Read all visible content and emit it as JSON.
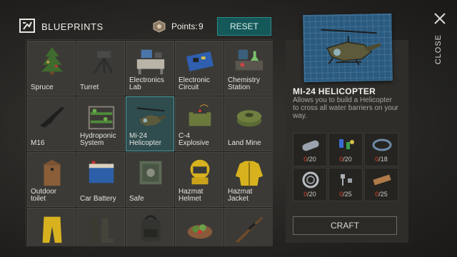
{
  "header": {
    "title": "BLUEPRINTS",
    "points_label": "Points:",
    "points_value": "9",
    "reset_label": "RESET"
  },
  "blueprints": [
    {
      "label": "Spruce",
      "icon": "spruce-icon",
      "selected": false
    },
    {
      "label": "Turret",
      "icon": "turret-icon",
      "selected": false
    },
    {
      "label": "Electronics Lab",
      "icon": "electronics-lab-icon",
      "selected": false
    },
    {
      "label": "Electronic Circuit",
      "icon": "electronic-circuit-icon",
      "selected": false
    },
    {
      "label": "Chemistry Station",
      "icon": "chemistry-station-icon",
      "selected": false
    },
    {
      "label": "M16",
      "icon": "m16-icon",
      "selected": false
    },
    {
      "label": "Hydroponic System",
      "icon": "hydroponic-icon",
      "selected": false
    },
    {
      "label": "Mi-24 Helicopter",
      "icon": "helicopter-icon",
      "selected": true
    },
    {
      "label": "C-4 Explosive",
      "icon": "c4-icon",
      "selected": false
    },
    {
      "label": "Land Mine",
      "icon": "land-mine-icon",
      "selected": false
    },
    {
      "label": "Outdoor toilet",
      "icon": "outdoor-toilet-icon",
      "selected": false
    },
    {
      "label": "Car Battery",
      "icon": "car-battery-icon",
      "selected": false
    },
    {
      "label": "Safe",
      "icon": "safe-icon",
      "selected": false
    },
    {
      "label": "Hazmat Helmet",
      "icon": "hazmat-helmet-icon",
      "selected": false
    },
    {
      "label": "Hazmat Jacket",
      "icon": "hazmat-jacket-icon",
      "selected": false
    },
    {
      "label": "",
      "icon": "hazmat-pants-icon",
      "selected": false
    },
    {
      "label": "",
      "icon": "boots-icon",
      "selected": false
    },
    {
      "label": "",
      "icon": "backpack-icon",
      "selected": false
    },
    {
      "label": "",
      "icon": "food-bowl-icon",
      "selected": false
    },
    {
      "label": "",
      "icon": "sniper-rifle-icon",
      "selected": false
    }
  ],
  "detail": {
    "name": "MI-24 HELICOPTER",
    "description": "Allows you to build a Helicopter to cross all water barriers on your way.",
    "ingredients": [
      {
        "icon": "metal-pipe-icon",
        "have": "0",
        "need": "/20"
      },
      {
        "icon": "electronic-parts-icon",
        "have": "0",
        "need": "/20"
      },
      {
        "icon": "wire-coil-icon",
        "have": "0",
        "need": "/18"
      },
      {
        "icon": "bearing-icon",
        "have": "0",
        "need": "/20"
      },
      {
        "icon": "bolts-icon",
        "have": "0",
        "need": "/25"
      },
      {
        "icon": "wood-plank-icon",
        "have": "0",
        "need": "/25"
      }
    ],
    "craft_label": "CRAFT"
  },
  "close_label": "CLOSE",
  "colors": {
    "accent": "#15585a",
    "selected_cell": "#2f4c4f",
    "missing_count": "#e0462f"
  }
}
